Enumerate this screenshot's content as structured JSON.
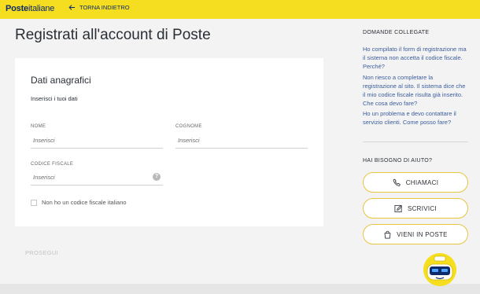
{
  "header": {
    "logo_bold": "Poste",
    "logo_light": "italiane",
    "back_label": "TORNA INDIETRO"
  },
  "page": {
    "title": "Registrati all'account di Poste"
  },
  "form": {
    "section_title": "Dati anagrafici",
    "section_subtitle": "Inserisci i tuoi dati",
    "nome": {
      "label": "NOME",
      "placeholder": "Inserisci"
    },
    "cognome": {
      "label": "COGNOME",
      "placeholder": "Inserisci"
    },
    "codice_fiscale": {
      "label": "CODICE FISCALE",
      "placeholder": "Inserisci",
      "help": "?"
    },
    "checkbox_label": "Non ho un codice fiscale italiano",
    "submit_label": "PROSEGUI"
  },
  "sidebar": {
    "related_title": "DOMANDE COLLEGATE",
    "links": [
      "Ho compilato il form di registrazione ma il sistema non accetta il codice fiscale. Perché?",
      "Non riesco a completare la registrazione al sito. Il sistema dice che il mio codice fiscale risulta già inserito. Che cosa devo fare?",
      "Ho un problema e devo contattare il servizio clienti. Come posso fare?"
    ],
    "help_title": "HAI BISOGNO DI AIUTO?",
    "buttons": [
      {
        "label": "CHIAMACI",
        "icon": "phone-icon"
      },
      {
        "label": "SCRIVICI",
        "icon": "pencil-icon"
      },
      {
        "label": "VIENI IN POSTE",
        "icon": "shopping-bag-icon"
      }
    ]
  },
  "colors": {
    "brand_yellow": "#f5dd1f",
    "brand_blue": "#0d2b6b",
    "link_blue": "#3b5d9c"
  }
}
